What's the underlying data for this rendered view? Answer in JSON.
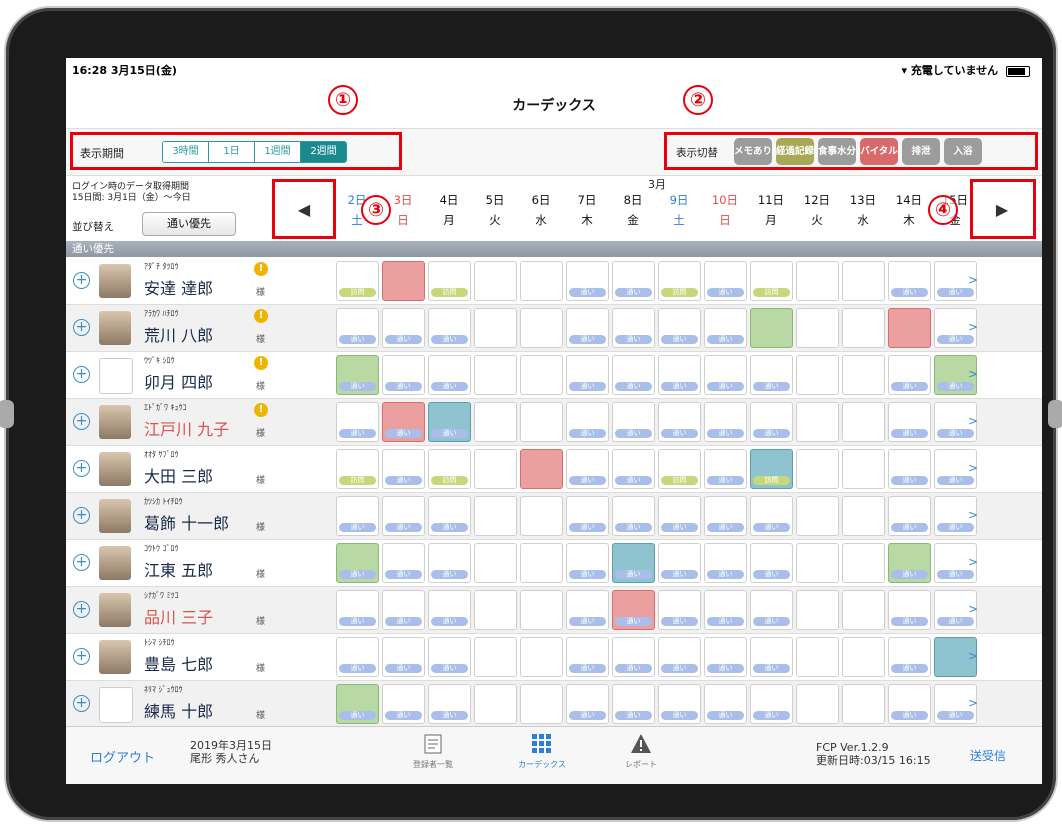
{
  "status": {
    "time": "16:28  3月15日(金)",
    "right": "充電していません"
  },
  "nav": {
    "title": "カーデックス"
  },
  "toolbar": {
    "period_label": "表示期間",
    "periods": [
      "3時間",
      "1日",
      "1週間",
      "2週間"
    ],
    "toggle_label": "表示切替",
    "toggles": [
      {
        "label": "メモあり",
        "color": "#9c9c9c"
      },
      {
        "label": "経過記録",
        "color": "#a8a857"
      },
      {
        "label": "食事水分",
        "color": "#9c9c9c"
      },
      {
        "label": "バイタル",
        "color": "#d96a6a"
      },
      {
        "label": "排泄",
        "color": "#9c9c9c"
      },
      {
        "label": "入浴",
        "color": "#9c9c9c"
      }
    ]
  },
  "info": {
    "line1": "ログイン時のデータ取得期間",
    "line2": "15日間:  3月1日（金）〜今日"
  },
  "sort": {
    "label": "並び替え",
    "button": "通い優先"
  },
  "nav_arrows": {
    "prev": "◀",
    "next": "▶"
  },
  "calendar": {
    "month": "3月",
    "days": [
      {
        "d": "2日",
        "w": "土",
        "c": "blue"
      },
      {
        "d": "3日",
        "w": "日",
        "c": "red"
      },
      {
        "d": "4日",
        "w": "月",
        "c": ""
      },
      {
        "d": "5日",
        "w": "火",
        "c": ""
      },
      {
        "d": "6日",
        "w": "水",
        "c": ""
      },
      {
        "d": "7日",
        "w": "木",
        "c": ""
      },
      {
        "d": "8日",
        "w": "金",
        "c": ""
      },
      {
        "d": "9日",
        "w": "土",
        "c": "blue"
      },
      {
        "d": "10日",
        "w": "日",
        "c": "red"
      },
      {
        "d": "11日",
        "w": "月",
        "c": ""
      },
      {
        "d": "12日",
        "w": "火",
        "c": ""
      },
      {
        "d": "13日",
        "w": "水",
        "c": ""
      },
      {
        "d": "14日",
        "w": "木",
        "c": ""
      },
      {
        "d": "15日",
        "w": "金",
        "c": ""
      }
    ]
  },
  "group": {
    "label": "通い優先"
  },
  "residents": [
    {
      "kana": "ｱﾀﾞﾁ ﾀﾂﾛｳ",
      "name": "安達 達郎",
      "red": false,
      "warn": true,
      "photo": true,
      "cells": [
        "h",
        "rx",
        "h",
        "",
        "",
        "k",
        "k",
        "h",
        "k",
        "h",
        "",
        "",
        "k",
        "k"
      ]
    },
    {
      "kana": "ｱﾗｶﾜ ﾊﾁﾛｳ",
      "name": "荒川 八郎",
      "red": false,
      "warn": true,
      "photo": true,
      "cells": [
        "k",
        "k",
        "k",
        "",
        "",
        "k",
        "k",
        "k",
        "k",
        "g",
        "",
        "",
        "r",
        "k"
      ]
    },
    {
      "kana": "ｳﾂﾞｷ ｼﾛｳ",
      "name": "卯月 四郎",
      "red": false,
      "warn": true,
      "photo": false,
      "cells": [
        "gk",
        "k",
        "k",
        "",
        "",
        "k",
        "k",
        "k",
        "k",
        "k",
        "",
        "",
        "k",
        "gk"
      ]
    },
    {
      "kana": "ｴﾄﾞｶﾞﾜ ｷｭｳｺ",
      "name": "江戸川 九子",
      "red": true,
      "warn": true,
      "photo": true,
      "cells": [
        "k",
        "rk",
        "bk",
        "",
        "",
        "k",
        "k",
        "k",
        "k",
        "k",
        "",
        "",
        "k",
        "k"
      ]
    },
    {
      "kana": "ｵｵﾀ ｻﾌﾞﾛｳ",
      "name": "大田 三郎",
      "red": false,
      "warn": false,
      "photo": true,
      "cells": [
        "h",
        "k",
        "h",
        "",
        "rx",
        "k",
        "k",
        "h",
        "k",
        "bh",
        "",
        "",
        "k",
        "k"
      ]
    },
    {
      "kana": "ｶﾂｼｶ ﾄｲﾁﾛｳ",
      "name": "葛飾 十一郎",
      "red": false,
      "warn": false,
      "photo": true,
      "cells": [
        "k",
        "k",
        "k",
        "",
        "",
        "k",
        "k",
        "k",
        "k",
        "k",
        "",
        "",
        "k",
        "k"
      ]
    },
    {
      "kana": "ｺｳﾄｳ ｺﾞﾛｳ",
      "name": "江東 五郎",
      "red": false,
      "warn": false,
      "photo": true,
      "cells": [
        "gk",
        "k",
        "k",
        "",
        "",
        "k",
        "bk",
        "k",
        "k",
        "k",
        "",
        "",
        "gk",
        "k"
      ]
    },
    {
      "kana": "ｼﾅｶﾞﾜ ﾐﾂｺ",
      "name": "品川 三子",
      "red": true,
      "warn": false,
      "photo": true,
      "cells": [
        "k",
        "k",
        "k",
        "",
        "",
        "k",
        "rk",
        "k",
        "k",
        "k",
        "",
        "",
        "k",
        "k"
      ]
    },
    {
      "kana": "ﾄｼﾏ ｼﾁﾛｳ",
      "name": "豊島 七郎",
      "red": false,
      "warn": false,
      "photo": true,
      "cells": [
        "k",
        "k",
        "k",
        "",
        "",
        "k",
        "k",
        "k",
        "k",
        "k",
        "",
        "",
        "k",
        "bx"
      ]
    },
    {
      "kana": "ﾈﾘﾏ ｼﾞｭｳﾛｳ",
      "name": "練馬 十郎",
      "red": false,
      "warn": false,
      "photo": false,
      "cells": [
        "gk",
        "k",
        "k",
        "",
        "",
        "k",
        "k",
        "k",
        "k",
        "k",
        "",
        "",
        "k",
        "k"
      ]
    }
  ],
  "pills": {
    "k": "通い",
    "h": "訪問"
  },
  "sama": "様",
  "tabbar": {
    "logout": "ログアウト",
    "date": "2019年3月15日",
    "user": "尾形 秀人さん",
    "tabs": [
      "登録者一覧",
      "カーデックス",
      "レポート"
    ],
    "version": "FCP Ver.1.2.9",
    "updated": "更新日時:03/15 16:15",
    "send": "送受信"
  },
  "annotations": [
    "①",
    "②",
    "③",
    "④"
  ]
}
